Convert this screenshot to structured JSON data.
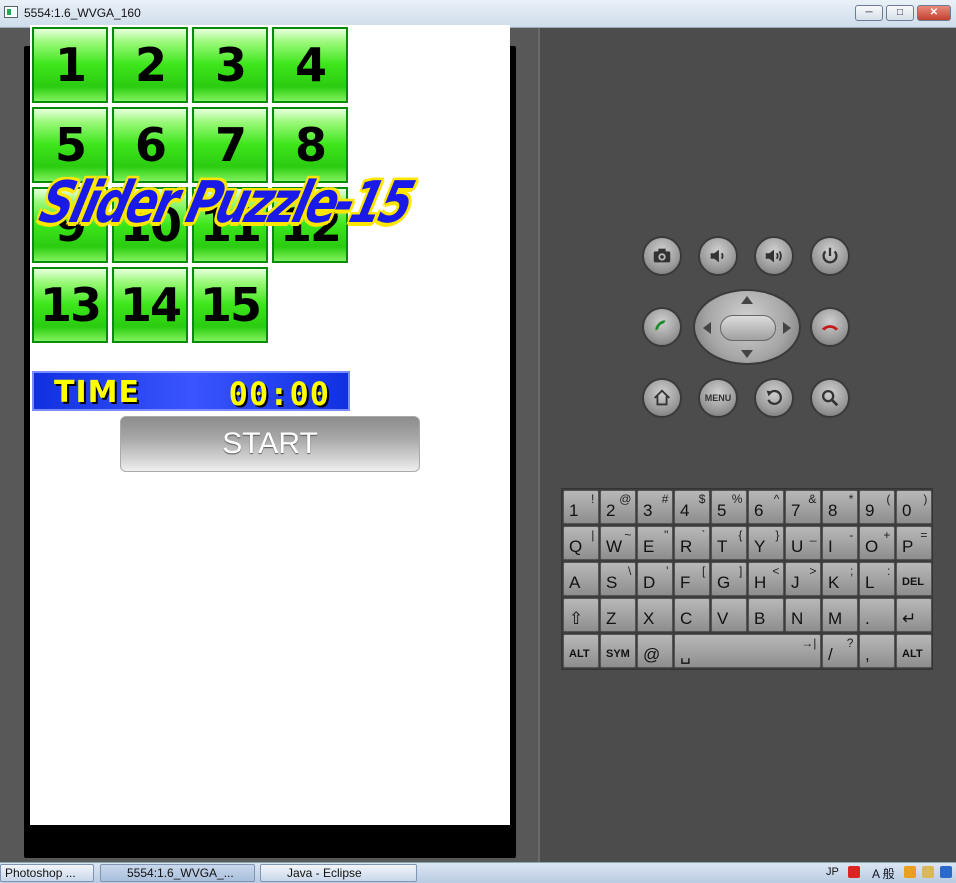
{
  "window": {
    "title": "5554:1.6_WVGA_160",
    "controls": {
      "minimize": "─",
      "maximize": "□",
      "close": "✕"
    }
  },
  "game": {
    "tiles": [
      "1",
      "2",
      "3",
      "4",
      "5",
      "6",
      "7",
      "8",
      "9",
      "10",
      "11",
      "12",
      "13",
      "14",
      "15"
    ],
    "logo": "Slider Puzzle-15",
    "time_label": "TIME",
    "time_value": "00:00",
    "start_label": "START"
  },
  "hardware_buttons": {
    "camera": "camera-icon",
    "volume_down": "volume-down-icon",
    "volume_up": "volume-up-icon",
    "power": "power-icon",
    "call": "call-icon",
    "end_call": "end-call-icon",
    "home": "home-icon",
    "menu_label": "MENU",
    "back": "back-icon",
    "search": "search-icon"
  },
  "keyboard": {
    "rows": [
      [
        {
          "m": "1",
          "a": "!"
        },
        {
          "m": "2",
          "a": "@"
        },
        {
          "m": "3",
          "a": "#"
        },
        {
          "m": "4",
          "a": "$"
        },
        {
          "m": "5",
          "a": "%"
        },
        {
          "m": "6",
          "a": "^"
        },
        {
          "m": "7",
          "a": "&"
        },
        {
          "m": "8",
          "a": "*"
        },
        {
          "m": "9",
          "a": "("
        },
        {
          "m": "0",
          "a": ")"
        }
      ],
      [
        {
          "m": "Q",
          "a": "|"
        },
        {
          "m": "W",
          "a": "~"
        },
        {
          "m": "E",
          "a": "\""
        },
        {
          "m": "R",
          "a": "`"
        },
        {
          "m": "T",
          "a": "{"
        },
        {
          "m": "Y",
          "a": "}"
        },
        {
          "m": "U",
          "a": "_"
        },
        {
          "m": "I",
          "a": "-"
        },
        {
          "m": "O",
          "a": "+"
        },
        {
          "m": "P",
          "a": "="
        }
      ],
      [
        {
          "m": "A",
          "a": ""
        },
        {
          "m": "S",
          "a": "\\"
        },
        {
          "m": "D",
          "a": "'"
        },
        {
          "m": "F",
          "a": "["
        },
        {
          "m": "G",
          "a": "]"
        },
        {
          "m": "H",
          "a": "<"
        },
        {
          "m": "J",
          "a": ">"
        },
        {
          "m": "K",
          "a": ";"
        },
        {
          "m": "L",
          "a": ":"
        },
        {
          "m": "DEL",
          "a": ""
        }
      ],
      [
        {
          "m": "⇧",
          "a": ""
        },
        {
          "m": "Z",
          "a": ""
        },
        {
          "m": "X",
          "a": ""
        },
        {
          "m": "C",
          "a": ""
        },
        {
          "m": "V",
          "a": ""
        },
        {
          "m": "B",
          "a": ""
        },
        {
          "m": "N",
          "a": ""
        },
        {
          "m": "M",
          "a": ""
        },
        {
          "m": ".",
          "a": ""
        },
        {
          "m": "↵",
          "a": ""
        }
      ],
      [
        {
          "m": "ALT",
          "a": ""
        },
        {
          "m": "SYM",
          "a": ""
        },
        {
          "m": "@",
          "a": ""
        },
        {
          "m": "␣",
          "a": "→|"
        },
        {
          "m": "/",
          "a": "?"
        },
        {
          "m": ",",
          "a": ""
        },
        {
          "m": "ALT",
          "a": ""
        }
      ]
    ]
  },
  "taskbar": {
    "items": [
      "Photoshop ...",
      "5554:1.6_WVGA_...",
      "Java - Eclipse"
    ],
    "tray": {
      "lang": "JP",
      "ime": "A 般"
    }
  }
}
